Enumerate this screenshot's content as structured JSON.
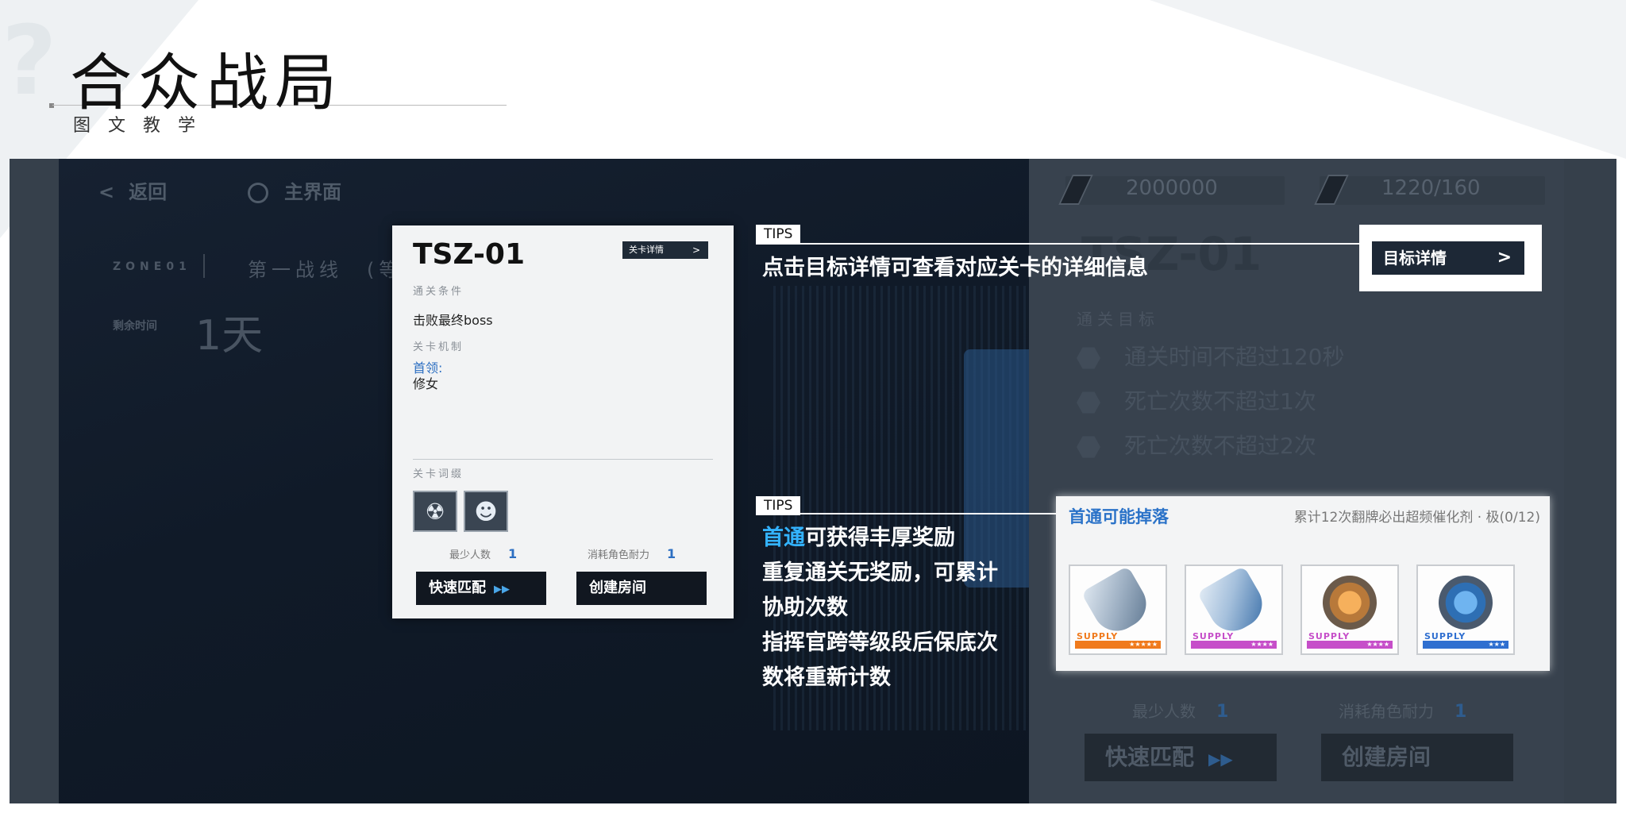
{
  "slide": {
    "title": "合众战局",
    "subtitle": "图文教学"
  },
  "game": {
    "nav": {
      "back_label": "返回",
      "home_label": "主界面"
    },
    "zone": {
      "code": "ZONE01",
      "name": "第一战线　(等"
    },
    "remaining_time": {
      "label": "剩余时间",
      "value": "1天"
    },
    "currencies": [
      {
        "icon": "ticket-icon",
        "value": "2000000"
      },
      {
        "icon": "stamina-icon",
        "value": "1220/160"
      }
    ],
    "background_panel": {
      "stage_id": "TSZ-01",
      "goal_title": "通关目标",
      "goals": [
        "通关时间不超过120秒",
        "死亡次数不超过1次",
        "死亡次数不超过2次"
      ],
      "min_players_label": "最少人数",
      "min_players_value": "1",
      "stamina_cost_label": "消耗角色耐力",
      "stamina_cost_value": "1",
      "quick_match_label": "快速匹配",
      "create_room_label": "创建房间"
    }
  },
  "card": {
    "stage_id": "TSZ-01",
    "detail_button": "关卡详情",
    "clear_condition_label": "通关条件",
    "clear_condition": "击败最终boss",
    "mechanic_label": "关卡机制",
    "boss_label": "首领:",
    "boss_name": "修女",
    "affix_label": "关卡词缀",
    "min_players_label": "最少人数",
    "min_players_value": "1",
    "stamina_cost_label": "消耗角色耐力",
    "stamina_cost_value": "1",
    "quick_match_label": "快速匹配",
    "create_room_label": "创建房间"
  },
  "tips": {
    "tag": "TIPS",
    "tip1": "点击目标详情可查看对应关卡的详细信息",
    "tip2_highlight": "首通",
    "tip2_line1_rest": "可获得丰厚奖励",
    "tip2_line2": "重复通关无奖励，可累计",
    "tip2_line3": "协助次数",
    "tip2_line4": "指挥官跨等级段后保底次",
    "tip2_line5": "数将重新计数"
  },
  "target_button": "目标详情",
  "drops": {
    "title": "首通可能掉落",
    "note": "累计12次翻牌必出超频催化剂 · 极(0/12)",
    "items": [
      {
        "label": "SUPPLY",
        "stars": "★★★★★",
        "color": "#f07a1c"
      },
      {
        "label": "SUPPLY",
        "stars": "★★★★",
        "color": "#c64ec9"
      },
      {
        "label": "SUPPLY",
        "stars": "★★★★",
        "color": "#c64ec9"
      },
      {
        "label": "SUPPLY",
        "stars": "★★★",
        "color": "#2f6fd0"
      }
    ]
  },
  "colors": {
    "accent_blue": "#2d6fc2",
    "highlight_cyan": "#33b3ff",
    "dark_button": "#111720"
  }
}
